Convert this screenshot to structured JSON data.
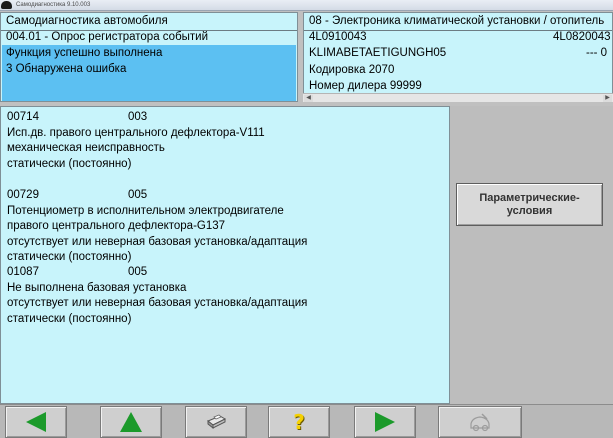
{
  "window": {
    "title": "Самодиагностика 9.10.003"
  },
  "header_left": {
    "line1": "Самодиагностика автомобиля",
    "line2": "004.01 - Опрос регистратора событий",
    "line3": "Функция успешно выполнена",
    "line4": "3 Обнаружена ошибка"
  },
  "header_right": {
    "line1": "08 - Электроника климатической установки / отопитель",
    "part_number": "4L0910043",
    "part_number_right": "4L0820043",
    "line3": "KLIMABETAETIGUNGH05",
    "line3_right": "--- 0",
    "coding": "Кодировка 2070",
    "dealer": "Номер дилера 99999"
  },
  "faults": [
    {
      "code": "00714",
      "status": "003",
      "lines": [
        "Исп.дв. правого центрального дефлектора-V111",
        "механическая неисправность",
        "статически (постоянно)"
      ]
    },
    {
      "code": "00729",
      "status": "005",
      "lines": [
        "Потенциометр в исполнительном электродвигателе",
        "правого центрального дефлектора-G137",
        "отсутствует или неверная базовая установка/адаптация",
        "статически (постоянно)"
      ]
    },
    {
      "code": "01087",
      "status": "005",
      "lines": [
        "Не выполнена базовая установка",
        "отсутствует или неверная базовая установка/адаптация",
        "статически (постоянно)"
      ]
    }
  ],
  "side": {
    "param_button_line1": "Параметрические-",
    "param_button_line2": "условия"
  },
  "toolbar": {
    "buttons": [
      "back-arrow",
      "up-arrow",
      "print",
      "help",
      "forward-arrow",
      "disabled-tool"
    ]
  },
  "colors": {
    "panel_bg": "#c8f4fb",
    "highlight": "#5cc0f2",
    "arrow_green": "#1c9a2b",
    "help_yellow": "#f5d000"
  }
}
